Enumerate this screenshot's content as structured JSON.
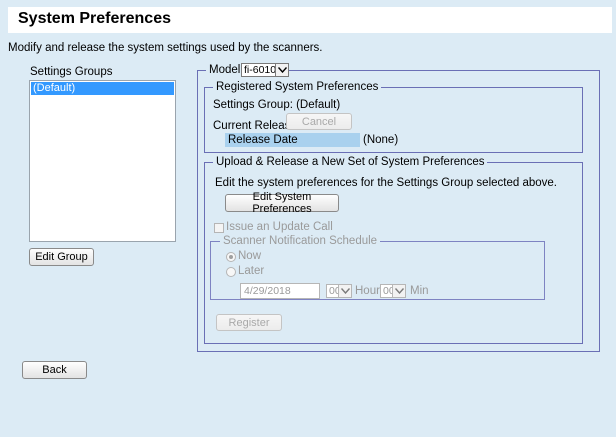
{
  "header": {
    "title": "System Preferences"
  },
  "description": "Modify and release the system settings used by the scanners.",
  "settings_groups": {
    "label": "Settings Groups",
    "items": [
      "(Default)"
    ],
    "edit_button": "Edit Group"
  },
  "model": {
    "label": "Model:",
    "value": "fi-6010N"
  },
  "registered": {
    "legend": "Registered System Preferences",
    "settings_group_text": "Settings Group: (Default)",
    "current_release_label": "Current Release",
    "cancel_button": "Cancel",
    "release_date_label": "Release Date",
    "release_date_value": "(None)"
  },
  "upload": {
    "legend": "Upload & Release a New Set of System Preferences",
    "instruction": "Edit the system preferences for the Settings Group selected above.",
    "edit_button": "Edit System Preferences",
    "issue_update_label": "Issue an Update Call",
    "schedule": {
      "legend": "Scanner Notification Schedule",
      "now_label": "Now",
      "later_label": "Later",
      "date_value": "4/29/2018",
      "hour_value": "00",
      "hour_label": "Hour",
      "min_value": "00",
      "min_label": "Min"
    },
    "register_button": "Register"
  },
  "back_button": "Back"
}
